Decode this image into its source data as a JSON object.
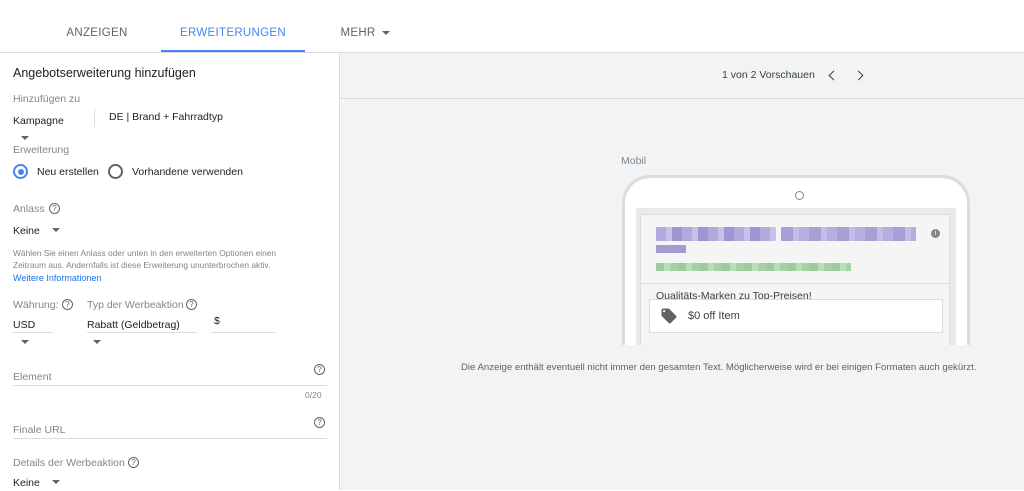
{
  "tabs": [
    {
      "label": "ANZEIGEN"
    },
    {
      "label": "ERWEITERUNGEN",
      "active": true
    },
    {
      "label": "MEHR"
    }
  ],
  "form": {
    "heading": "Angebotserweiterung hinzufügen",
    "add_to_label": "Hinzufügen zu",
    "add_to_value": "Kampagne",
    "campaign_name": "DE | Brand + Fahrradtyp",
    "extension_label": "Erweiterung",
    "radio_new": "Neu erstellen",
    "radio_existing": "Vorhandene verwenden",
    "occasion_label": "Anlass",
    "occasion_value": "Keine",
    "occasion_help_line1": "Wählen Sie einen Anlass oder unten in den erweiterten Optionen einen",
    "occasion_help_line2": "Zeitraum aus. Andernfalls ist diese Erweiterung ununterbrochen aktiv.",
    "more_info_link": "Weitere Informationen",
    "currency_label": "Währung:",
    "currency_value": "USD",
    "promo_type_label": "Typ der Werbeaktion",
    "promo_type_value": "Rabatt (Geldbetrag)",
    "amount_prefix": "$",
    "amount_value": "",
    "item_placeholder": "Element",
    "item_counter": "0/20",
    "final_url_placeholder": "Finale URL",
    "promo_details_label": "Details der Werbeaktion",
    "promo_details_value": "Keine"
  },
  "preview": {
    "pager_text": "1 von 2 Vorschauen",
    "device_label": "Mobil",
    "promo_title": "Qualitäts-Marken zu Top-Preisen!",
    "promo_offer": "$0 off Item",
    "disclaimer": "Die Anzeige enthält eventuell nicht immer den gesamten Text. Möglicherweise wird er bei einigen Formaten auch gekürzt."
  },
  "colors": {
    "accent": "#4285f4",
    "blur_purple": "#a59bd3",
    "blur_green": "#9ccc9c"
  }
}
